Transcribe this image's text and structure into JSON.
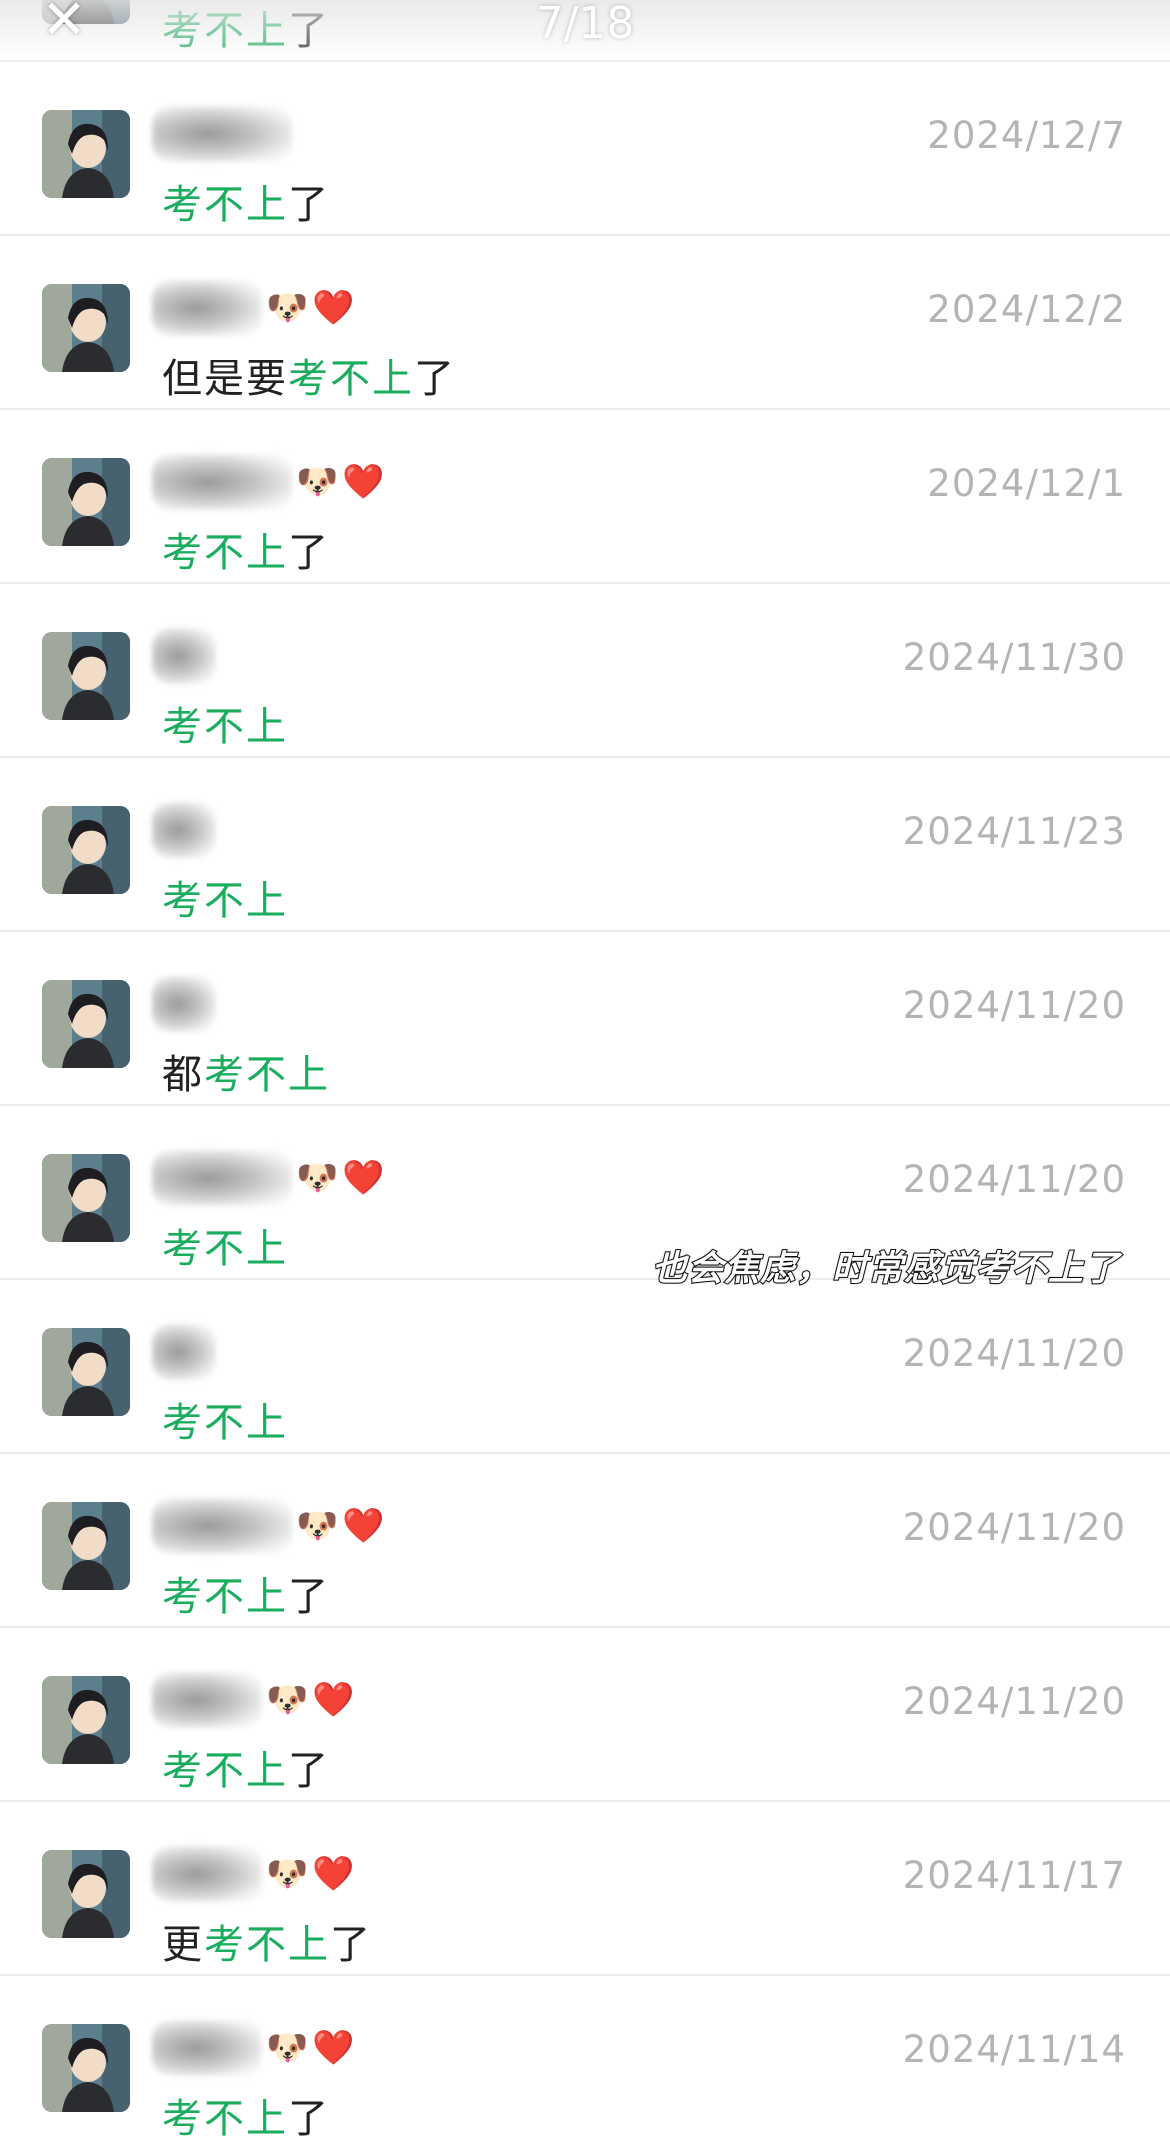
{
  "header": {
    "counter": "7/18",
    "close_icon": "close-icon"
  },
  "overlay_caption": "也会焦虑，时常感觉考不上了",
  "colors": {
    "highlight": "#1aad5e",
    "date": "#b4b4b4",
    "text": "#222222"
  },
  "rows": [
    {
      "date": "",
      "pre": "",
      "hl": "考不上",
      "post": "了",
      "emojis": []
    },
    {
      "date": "2024/12/7",
      "pre": "",
      "hl": "考不上",
      "post": "了",
      "emojis": []
    },
    {
      "date": "2024/12/2",
      "pre": "但是要",
      "hl": "考不上",
      "post": "了",
      "emojis": [
        "🐶",
        "❤️"
      ]
    },
    {
      "date": "2024/12/1",
      "pre": "",
      "hl": "考不上",
      "post": "了",
      "emojis": [
        "🐶",
        "❤️"
      ]
    },
    {
      "date": "2024/11/30",
      "pre": "",
      "hl": "考不上",
      "post": "",
      "emojis": []
    },
    {
      "date": "2024/11/23",
      "pre": "",
      "hl": "考不上",
      "post": "",
      "emojis": []
    },
    {
      "date": "2024/11/20",
      "pre": "都",
      "hl": "考不上",
      "post": "",
      "emojis": []
    },
    {
      "date": "2024/11/20",
      "pre": "",
      "hl": "考不上",
      "post": "",
      "emojis": [
        "🐶",
        "❤️"
      ]
    },
    {
      "date": "2024/11/20",
      "pre": "",
      "hl": "考不上",
      "post": "",
      "emojis": []
    },
    {
      "date": "2024/11/20",
      "pre": "",
      "hl": "考不上",
      "post": "了",
      "emojis": [
        "🐶",
        "❤️"
      ]
    },
    {
      "date": "2024/11/20",
      "pre": "",
      "hl": "考不上",
      "post": "了",
      "emojis": [
        "🐶",
        "❤️"
      ]
    },
    {
      "date": "2024/11/17",
      "pre": "更",
      "hl": "考不上",
      "post": "了",
      "emojis": [
        "🐶",
        "❤️"
      ]
    },
    {
      "date": "2024/11/14",
      "pre": "",
      "hl": "考不上",
      "post": "了",
      "emojis": [
        "🐶",
        "❤️"
      ]
    }
  ]
}
